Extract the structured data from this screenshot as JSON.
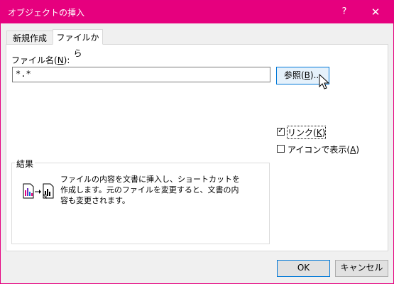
{
  "titlebar": {
    "title": "オブジェクトの挿入",
    "help": "?",
    "close": "✕"
  },
  "tabs": [
    {
      "label": "新規作成",
      "active": false
    },
    {
      "label": "ファイルから",
      "active": true
    }
  ],
  "file": {
    "label_prefix": "ファイル名(",
    "label_key": "N",
    "label_suffix": "):",
    "value": "*.*",
    "browse_prefix": "参照(",
    "browse_key": "B",
    "browse_suffix": ")..."
  },
  "options": {
    "link_prefix": "リンク(",
    "link_key": "K",
    "link_suffix": ")",
    "link_checked": true,
    "icon_prefix": "アイコンで表示(",
    "icon_key": "A",
    "icon_suffix": ")",
    "icon_checked": false
  },
  "result": {
    "title": "結果",
    "text": "ファイルの内容を文書に挿入し、ショートカットを作成します。元のファイルを変更すると、文書の内容も変更されます。"
  },
  "footer": {
    "ok": "OK",
    "cancel": "キャンセル"
  },
  "colors": {
    "titlebar": "#e6007e",
    "accent": "#0078d7"
  }
}
